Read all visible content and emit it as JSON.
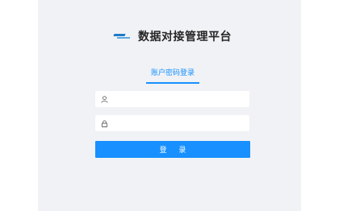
{
  "header": {
    "title": "数据对接管理平台",
    "logo_icon": "brand-logo-icon"
  },
  "tabs": [
    {
      "label": "账户密码登录",
      "active": true
    }
  ],
  "form": {
    "username": {
      "value": "",
      "placeholder": "",
      "icon": "user-icon"
    },
    "password": {
      "value": "",
      "placeholder": "",
      "icon": "lock-icon"
    },
    "submit_label": "登 录"
  },
  "colors": {
    "accent": "#1890ff",
    "panel_background": "#f0f2f5",
    "page_background": "#ffffff"
  }
}
